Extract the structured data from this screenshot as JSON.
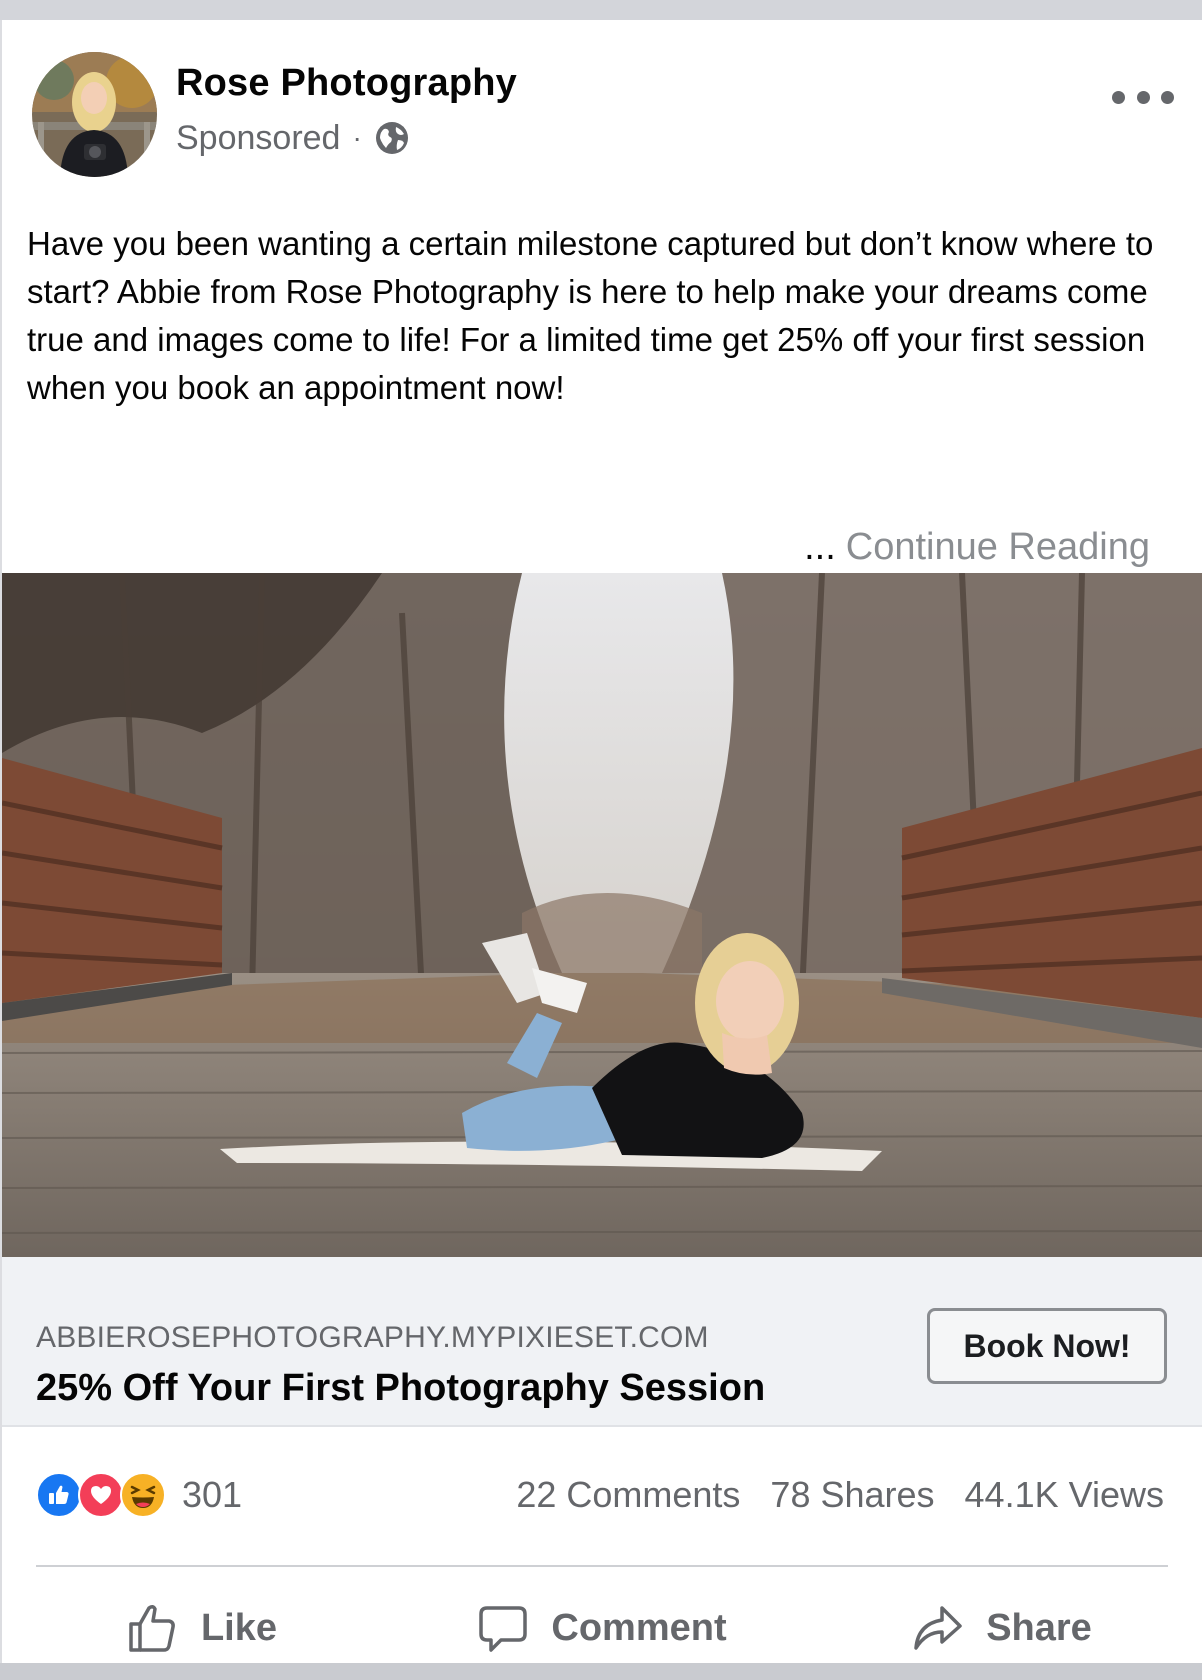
{
  "post": {
    "page_name": "Rose Photography",
    "sponsored_label": "Sponsored",
    "separator": "·",
    "body_text": "Have you been wanting a certain milestone captured but don’t know where to start? Abbie from Rose Photography is here to help make your dreams come true and images come to life! For a limited time get 25% off your first session when you book an appointment now!",
    "ellipsis": "...",
    "continue_label": "Continue Reading"
  },
  "link_preview": {
    "domain": "ABBIEROSEPHOTOGRAPHY.MYPIXIESET.COM",
    "title": "25% Off Your First Photography Session",
    "cta_label": "Book Now!"
  },
  "stats": {
    "reaction_count": "301",
    "reaction_icons": [
      "like-icon",
      "love-icon",
      "haha-icon"
    ],
    "comments": "22 Comments",
    "shares": "78 Shares",
    "views": "44.1K Views"
  },
  "actions": {
    "like": "Like",
    "comment": "Comment",
    "share": "Share"
  },
  "colors": {
    "like_blue": "#1877f2",
    "love_red": "#f33e58",
    "haha_yellow": "#f7b125",
    "secondary_text": "#65676b",
    "preview_bg": "#f0f2f5"
  }
}
